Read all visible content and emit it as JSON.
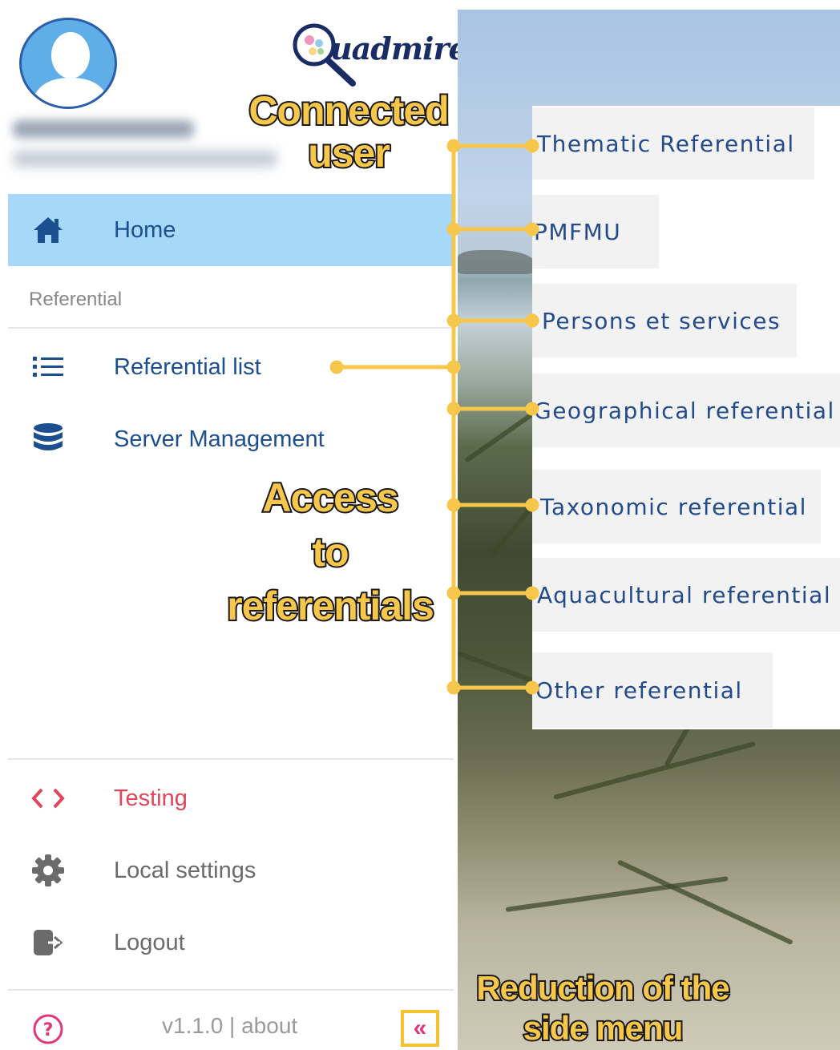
{
  "app": {
    "logo_text": "uadmire"
  },
  "user": {
    "name": "Alice LAMOUREUX",
    "email": "Alice.Lamoureux@ifremer.fr"
  },
  "menu": {
    "home_label": "Home",
    "section_referential": "Referential",
    "referential_list_label": "Referential list",
    "server_management_label": "Server Management",
    "testing_label": "Testing",
    "local_settings_label": "Local settings",
    "logout_label": "Logout",
    "version_text": "v1.1.0 | about",
    "collapse_symbol": "«"
  },
  "referentials": [
    "Thematic Referential",
    "PMFMU",
    "Persons et services",
    "Geographical referential",
    "Taxonomic referential",
    "Aquacultural referential",
    "Other referential"
  ],
  "annotations": {
    "connected_user": [
      "Connected",
      "user"
    ],
    "access_referentials": [
      "Access",
      "to",
      "referentials"
    ],
    "reduction_menu": [
      "Reduction of the",
      "side menu"
    ]
  },
  "colors": {
    "accent_blue": "#1c4f8f",
    "home_highlight": "#a7d8fa",
    "testing_red": "#e0455a",
    "annotation_yellow": "#f6c74a",
    "help_pink": "#e0357a"
  },
  "icons": {
    "home": "home-icon",
    "list": "list-icon",
    "database": "database-icon",
    "code": "code-icon",
    "gear": "gear-icon",
    "logout": "logout-icon",
    "help": "help-circle-icon",
    "collapse": "double-chevron-left-icon"
  }
}
